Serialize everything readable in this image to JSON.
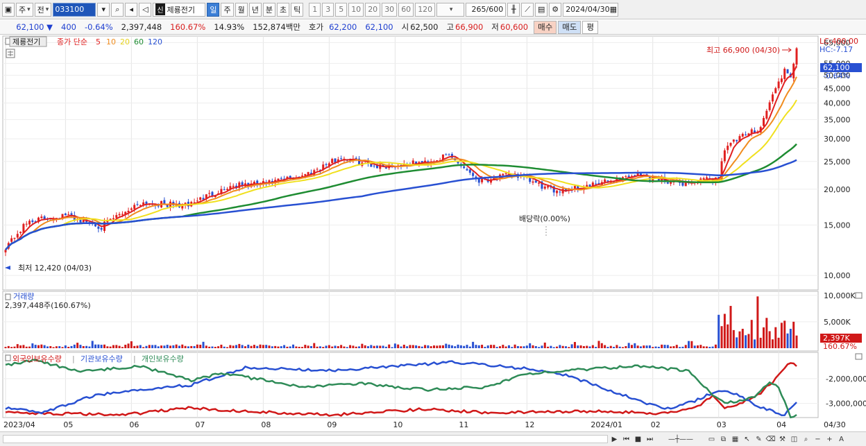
{
  "toolbar": {
    "market": "주",
    "prev": "전",
    "code": "033100",
    "stock_tag": "신",
    "stock_name": "제룡전기",
    "periods": [
      "일",
      "주",
      "월",
      "년",
      "분",
      "초",
      "틱"
    ],
    "active_period": "일",
    "intervals": [
      "1",
      "3",
      "5",
      "10",
      "20",
      "30",
      "60",
      "120"
    ],
    "count": "265",
    "count_total": "/600",
    "date": "2024/04/30"
  },
  "quote": {
    "price": "62,100",
    "change": "400",
    "change_pct": "-0.64%",
    "volume": "2,397,448",
    "volume_ratio": "160.67%",
    "turnover": "14.93%",
    "amount": "152,874백만",
    "bid_label": "호가",
    "bid": "62,200",
    "ask": "62,100",
    "open_label": "시",
    "open": "62,500",
    "high_label": "고",
    "high": "66,900",
    "low_label": "저",
    "low": "60,600",
    "buy_label": "매수",
    "sell_label": "매도",
    "flat_label": "평"
  },
  "price_panel": {
    "stock_label": "제룡전기",
    "ma_title": "종가 단순",
    "ma_labels": [
      {
        "label": "5",
        "color": "#e02020"
      },
      {
        "label": "10",
        "color": "#f08c1e"
      },
      {
        "label": "20",
        "color": "#e6d21e"
      },
      {
        "label": "60",
        "color": "#1e8c32"
      },
      {
        "label": "120",
        "color": "#2850d2"
      }
    ],
    "lc": "LC:400.00",
    "hc": "HC:-7.17",
    "max_note": "최고 66,900 (04/30)",
    "min_note": "최저 12,420 (04/03)",
    "dividend_note": "배당락(0.00%)",
    "price_tag": "62,100",
    "pct_tag": "-0.64%",
    "y_ticks": [
      "65,000",
      "55,000",
      "50,000",
      "45,000",
      "40,000",
      "35,000",
      "30,000",
      "25,000",
      "20,000",
      "15,000",
      "10,000"
    ]
  },
  "volume_panel": {
    "title": "거래량",
    "value": "2,397,448주(160.67%)",
    "y_ticks": [
      "10,000K",
      "5,000K"
    ],
    "tag": "2,397K",
    "tag_pct": "160.67%"
  },
  "holding_panel": {
    "legend": [
      {
        "label": "외국인보유수량",
        "color": "#d01818"
      },
      {
        "label": "기관보유수량",
        "color": "#2850d2"
      },
      {
        "label": "개인보유수량",
        "color": "#2e8b57"
      }
    ],
    "y_ticks": [
      "-2,000,000",
      "-3,000,000"
    ]
  },
  "x_axis": {
    "labels": [
      "2023/04",
      "05",
      "06",
      "07",
      "08",
      "09",
      "10",
      "11",
      "12",
      "2024/01",
      "02",
      "03",
      "04"
    ],
    "end_label": "04/30"
  },
  "colors": {
    "up": "#e02020",
    "down": "#2850d2",
    "accent": "#1f56b9"
  }
}
